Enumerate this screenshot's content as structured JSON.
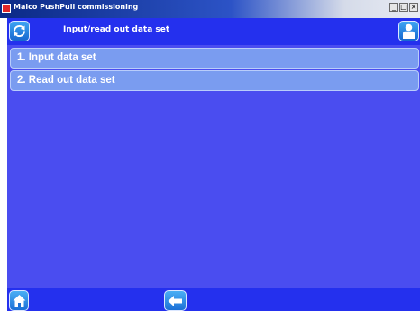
{
  "window": {
    "title": "Maico PushPull commissioning",
    "controls": {
      "minimize": "_",
      "maximize": "□",
      "close": "×"
    }
  },
  "header": {
    "title": "Input/read out data set",
    "refresh_icon": "refresh-icon",
    "user_icon": "user-icon"
  },
  "menu": {
    "items": [
      {
        "label": "1. Input data set"
      },
      {
        "label": "2. Read out data set"
      }
    ]
  },
  "footer": {
    "home_icon": "home-icon",
    "back_icon": "arrow-left-icon"
  },
  "colors": {
    "background": "#4a4df0",
    "bar": "#2430ee",
    "menu_item": "#7a9cf0",
    "button": "#1e7ae0"
  }
}
